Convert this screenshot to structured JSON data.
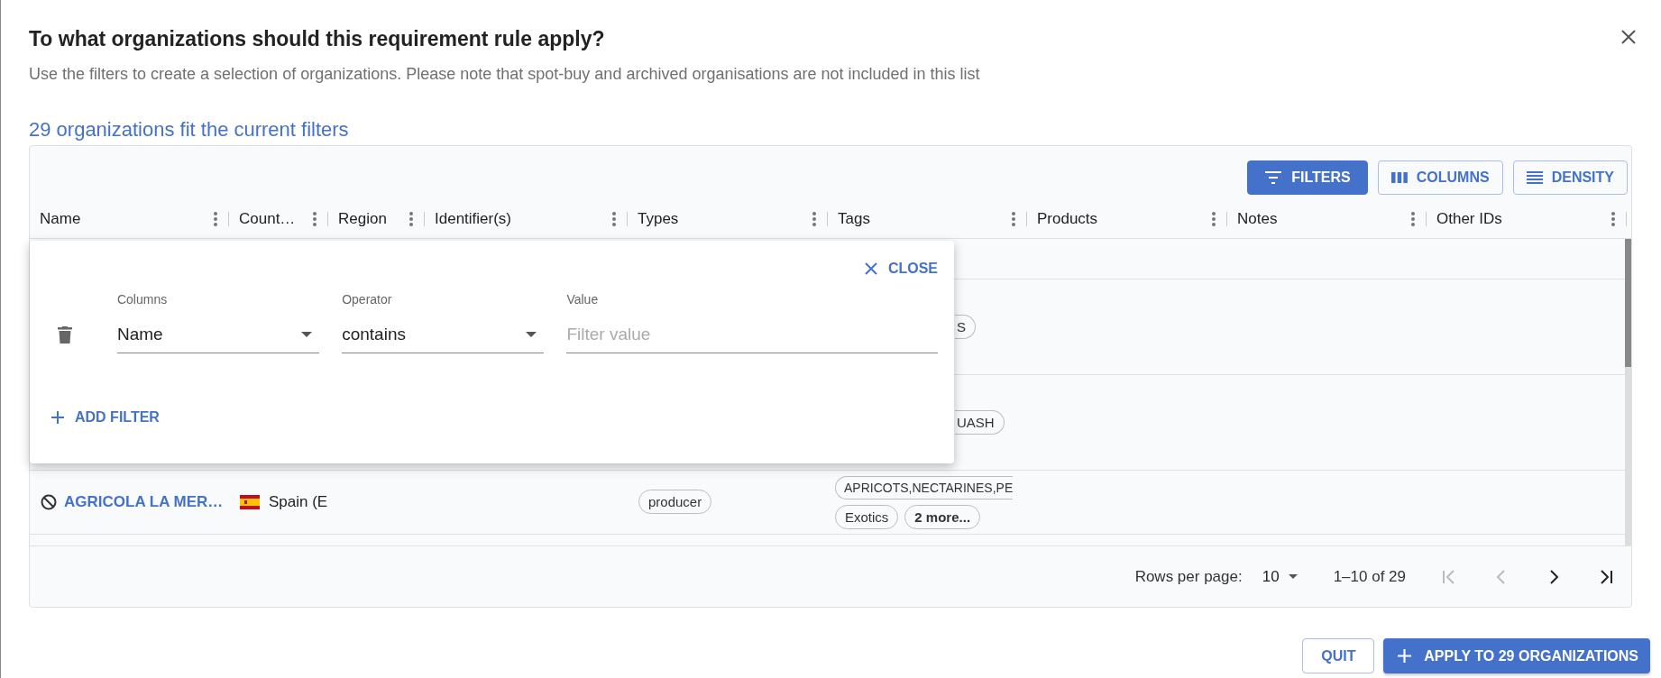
{
  "dialog": {
    "title": "To what organizations should this requirement rule apply?",
    "subtitle": "Use the filters to create a selection of organizations. Please note that spot-buy and archived organisations are not included in this list",
    "count_text": "29 organizations fit the current filters"
  },
  "toolbar": [
    {
      "kind": "filters",
      "label": "FILTERS",
      "selected": true
    },
    {
      "kind": "columns",
      "label": "COLUMNS",
      "selected": false
    },
    {
      "kind": "density",
      "label": "DENSITY",
      "selected": false
    }
  ],
  "table": {
    "columns": [
      "Name",
      "Count…",
      "Region",
      "Identifier(s)",
      "Types",
      "Tags",
      "Products",
      "Notes",
      "Other IDs"
    ],
    "rows": [
      {
        "kind": "empty"
      },
      {
        "kind": "covered",
        "tags": [
          {
            "kind": "plain",
            "label": "S"
          }
        ]
      },
      {
        "kind": "covered",
        "tags": [
          {
            "kind": "plain",
            "label": "UASH"
          }
        ]
      },
      {
        "kind": "full",
        "name": "AGRICOLA LA MER…",
        "country": "Spain (E",
        "types": [
          "producer"
        ],
        "tags": [
          {
            "kind": "clipped",
            "label": "APRICOTS,NECTARINES,PE"
          },
          {
            "kind": "plain",
            "label": "Exotics"
          },
          {
            "kind": "more",
            "label": "2 more..."
          }
        ]
      },
      {
        "kind": "empty"
      }
    ]
  },
  "filter_panel": {
    "close_label": "CLOSE",
    "columns_label": "Columns",
    "operator_label": "Operator",
    "value_label": "Value",
    "column_value": "Name",
    "operator_value": "contains",
    "value_placeholder": "Filter value",
    "add_label": "ADD FILTER"
  },
  "pagination": {
    "rows_per_page_label": "Rows per page:",
    "rows_per_page": "10",
    "range": "1–10 of 29",
    "buttons": [
      {
        "kind": "first",
        "disabled": true
      },
      {
        "kind": "prev",
        "disabled": true
      },
      {
        "kind": "next",
        "disabled": false
      },
      {
        "kind": "last",
        "disabled": false
      }
    ]
  },
  "actions": {
    "quit": "QUIT",
    "apply": "APPLY TO 29 ORGANIZATIONS"
  }
}
